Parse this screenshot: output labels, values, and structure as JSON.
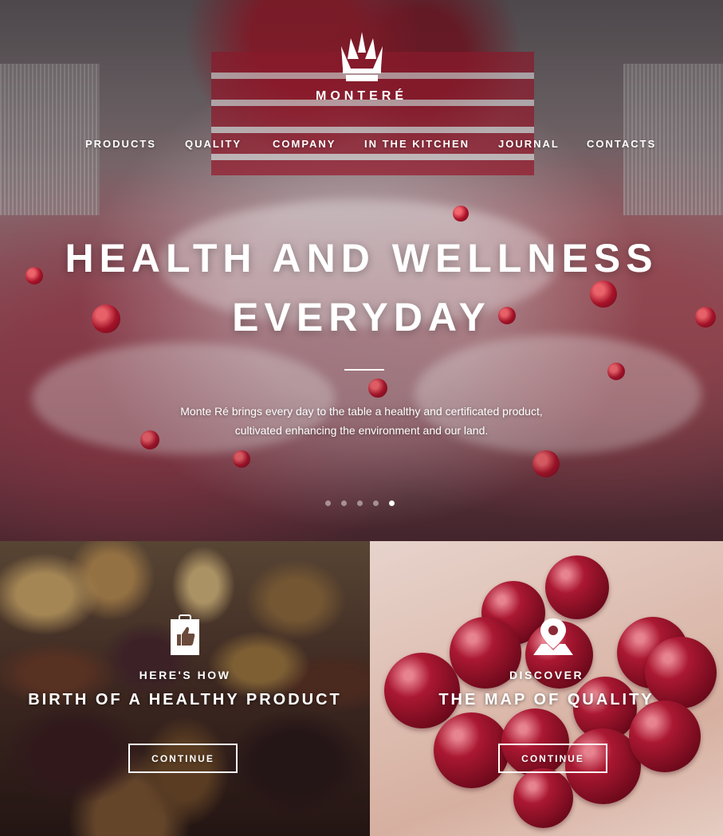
{
  "brand": {
    "name": "MONTERÉ"
  },
  "nav": {
    "items": [
      {
        "label": "PRODUCTS"
      },
      {
        "label": "QUALITY"
      },
      {
        "label": "COMPANY"
      },
      {
        "label": "IN THE KITCHEN"
      },
      {
        "label": "JOURNAL"
      },
      {
        "label": "CONTACTS"
      }
    ]
  },
  "hero": {
    "headline_line1": "HEALTH AND WELLNESS",
    "headline_line2": "EVERYDAY",
    "subtext_line1": "Monte Ré brings every day to the table a healthy and certificated product,",
    "subtext_line2": "cultivated enhancing the environment and our land.",
    "slides_count": 5,
    "active_slide": 5
  },
  "panels": [
    {
      "kicker": "HERE'S HOW",
      "title": "BIRTH OF A HEALTHY PRODUCT",
      "button": "CONTINUE",
      "icon": "thumbs-up-clipboard-icon"
    },
    {
      "kicker": "DISCOVER",
      "title": "THE MAP OF QUALITY",
      "button": "CONTINUE",
      "icon": "map-pin-icon"
    }
  ],
  "colors": {
    "accent": "#b21a34",
    "text": "#ffffff"
  }
}
